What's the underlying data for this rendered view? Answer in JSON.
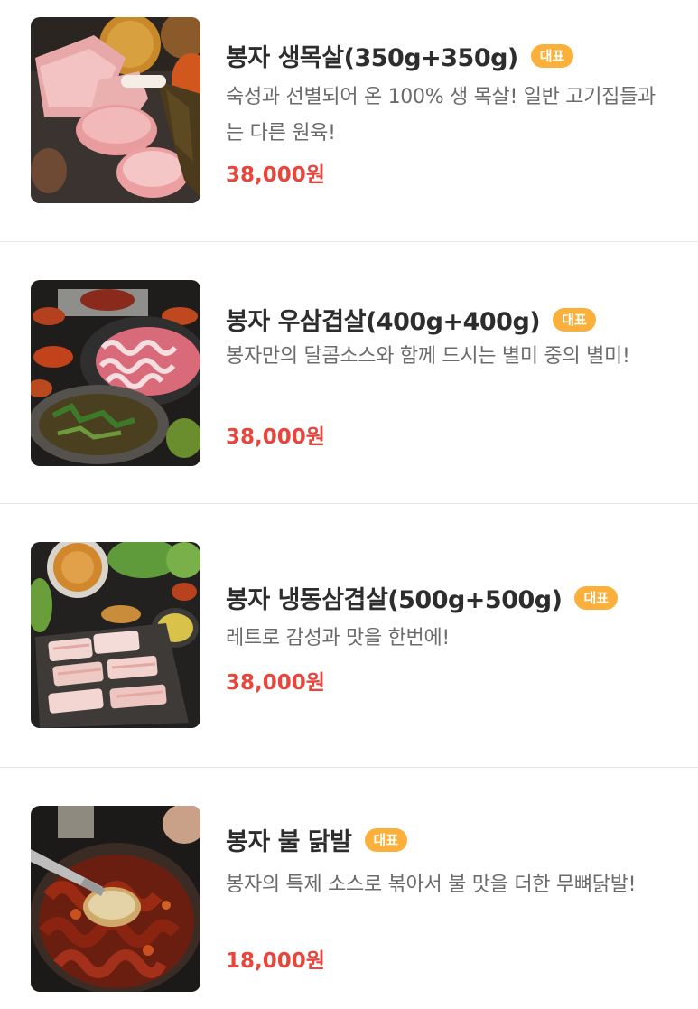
{
  "menu": {
    "items": [
      {
        "title": "봉자 생목살(350g+350g)",
        "badge": "대표",
        "description": "숙성과 선별되어 온 100% 생 목살! 일반 고기집들과는 다른 원육!",
        "price": "38,000원",
        "image_icon": "pork-neck-photo"
      },
      {
        "title": "봉자 우삼겹살(400g+400g)",
        "badge": "대표",
        "description": "봉자만의 달콤소스와 함께 드시는 별미 중의 별미!",
        "price": "38,000원",
        "image_icon": "beef-brisket-photo"
      },
      {
        "title": "봉자 냉동삼겹살(500g+500g)",
        "badge": "대표",
        "description": "레트로 감성과 맛을 한번에!",
        "price": "38,000원",
        "image_icon": "frozen-pork-belly-photo"
      },
      {
        "title": "봉자 불 닭발",
        "badge": "대표",
        "description": "봉자의 특제 소스로 볶아서 불 맛을 더한 무뼈닭발!",
        "price": "18,000원",
        "image_icon": "spicy-chicken-feet-photo"
      }
    ]
  },
  "colors": {
    "badge": "#fbb03b",
    "price": "#e8463c",
    "title": "#2d2d2d",
    "description": "#6b6b6b"
  }
}
